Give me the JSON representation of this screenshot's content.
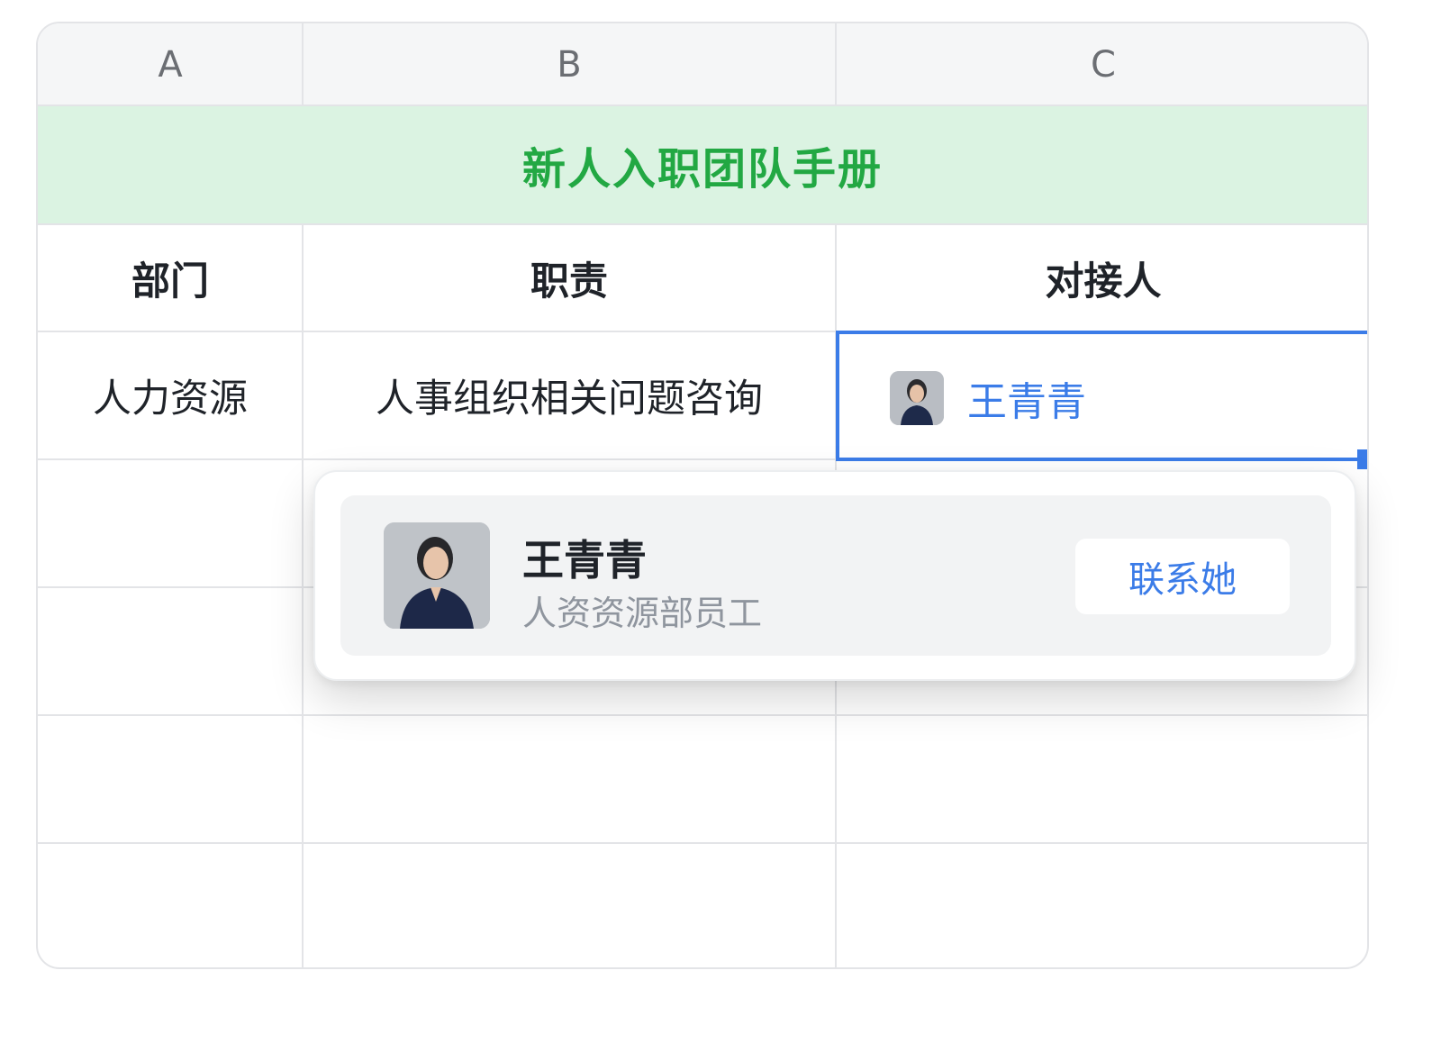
{
  "columns": [
    "A",
    "B",
    "C"
  ],
  "title": "新人入职团队手册",
  "headers": {
    "dept": "部门",
    "duty": "职责",
    "contact": "对接人"
  },
  "row": {
    "dept": "人力资源",
    "duty": "人事组织相关问题咨询",
    "contact_name": "王青青"
  },
  "popup": {
    "avatar": "person-photo",
    "name": "王青青",
    "role": "人资资源部员工",
    "contact_button": "联系她"
  },
  "colors": {
    "accent": "#3b7ce8",
    "title_text": "#22a843",
    "title_bg": "#dbf3e2",
    "grid": "#e3e4e7"
  }
}
